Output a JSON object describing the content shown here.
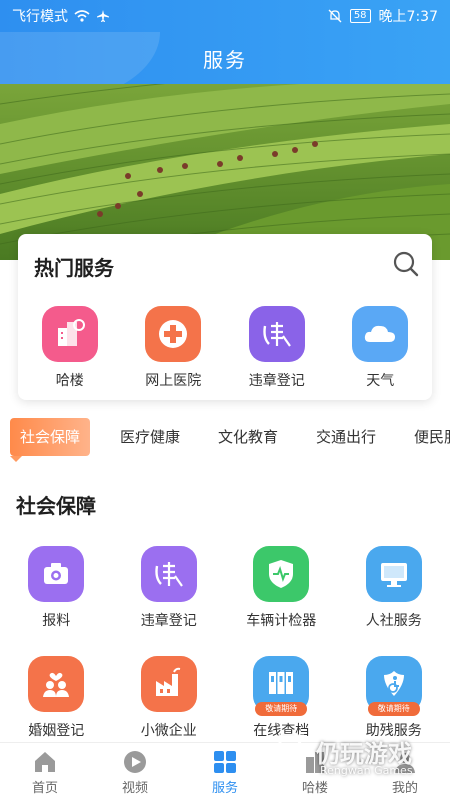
{
  "status_bar": {
    "left_text": "飞行模式",
    "battery": "58",
    "time": "晚上7:37"
  },
  "header": {
    "title": "服务"
  },
  "hot_services": {
    "title": "热门服务",
    "items": [
      {
        "label": "哈楼",
        "icon": "building-icon",
        "color": "#f45b8c"
      },
      {
        "label": "网上医院",
        "icon": "medical-cross-icon",
        "color": "#f4734a"
      },
      {
        "label": "违章登记",
        "icon": "traffic-violation-icon",
        "color": "#8a63e8"
      },
      {
        "label": "天气",
        "icon": "cloud-icon",
        "color": "#5aa8f5"
      }
    ]
  },
  "category_tabs": [
    "社会保障",
    "医疗健康",
    "文化教育",
    "交通出行",
    "便民服务"
  ],
  "section": {
    "title": "社会保障",
    "rows": [
      [
        {
          "label": "报料",
          "icon": "camera-icon",
          "color": "#9b6ff0",
          "badge": ""
        },
        {
          "label": "违章登记",
          "icon": "traffic-violation-icon",
          "color": "#9b6ff0",
          "badge": ""
        },
        {
          "label": "车辆计检器",
          "icon": "shield-pulse-icon",
          "color": "#3cc86a",
          "badge": ""
        },
        {
          "label": "人社服务",
          "icon": "monitor-icon",
          "color": "#4aa8ee",
          "badge": ""
        }
      ],
      [
        {
          "label": "婚姻登记",
          "icon": "couple-heart-icon",
          "color": "#f4734a",
          "badge": ""
        },
        {
          "label": "小微企业",
          "icon": "factory-icon",
          "color": "#f4734a",
          "badge": ""
        },
        {
          "label": "在线查档",
          "icon": "file-cabinet-icon",
          "color": "#4aa8ee",
          "badge": "敬请期待"
        },
        {
          "label": "助残服务",
          "icon": "disability-assist-icon",
          "color": "#4aa8ee",
          "badge": "敬请期待"
        }
      ]
    ]
  },
  "bottom_nav": [
    {
      "label": "首页",
      "icon": "home-icon",
      "active": false
    },
    {
      "label": "视频",
      "icon": "play-icon",
      "active": false
    },
    {
      "label": "服务",
      "icon": "grid-icon",
      "active": true
    },
    {
      "label": "哈楼",
      "icon": "building-icon",
      "active": false
    },
    {
      "label": "我的",
      "icon": "user-icon",
      "active": false
    }
  ],
  "watermark": {
    "title": "仍玩游戏",
    "subtitle": "Rengwan Games"
  },
  "colors": {
    "primary": "#2e8ff0",
    "accent": "#ff8a4a"
  }
}
